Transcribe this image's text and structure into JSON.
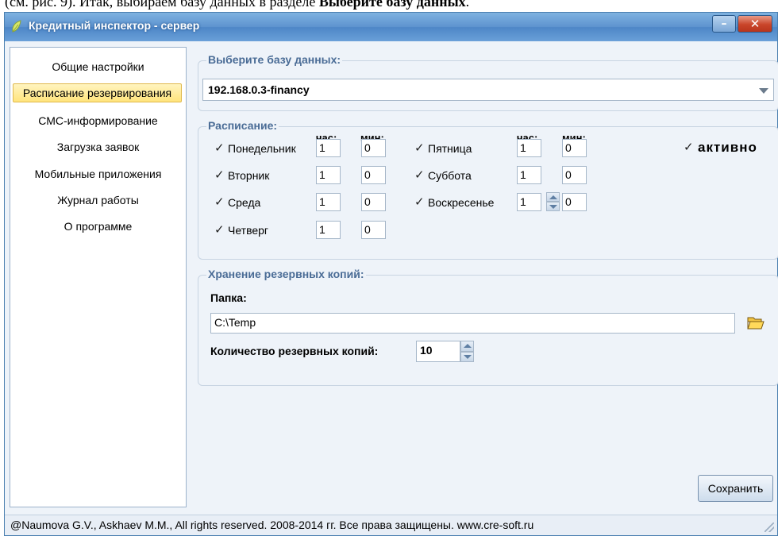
{
  "doc_text": {
    "prefix": "(см. рис. 9). Итак, выбираем базу данных в разделе ",
    "bold": "Выберите базу данных",
    "suffix": "."
  },
  "window": {
    "title": "Кредитный инспектор - сервер",
    "minimize_glyph": "–",
    "close_glyph": "✕"
  },
  "sidebar": {
    "items": [
      {
        "label": "Общие настройки"
      },
      {
        "label": "Расписание резервирования"
      },
      {
        "label": "СМС-информирование"
      },
      {
        "label": "Загрузка заявок"
      },
      {
        "label": "Мобильные приложения"
      },
      {
        "label": "Журнал работы"
      },
      {
        "label": "О программе"
      }
    ],
    "active_index": 1
  },
  "database": {
    "group_title": "Выберите базу данных:",
    "selected": "192.168.0.3-financy"
  },
  "schedule": {
    "group_title": "Расписание:",
    "hour_header": "час:",
    "min_header": "мин:",
    "active_label": "активно",
    "active_checked": true,
    "check_glyph": "✓",
    "days": [
      {
        "name": "Понедельник",
        "hour": "1",
        "min": "0",
        "checked": true
      },
      {
        "name": "Вторник",
        "hour": "1",
        "min": "0",
        "checked": true
      },
      {
        "name": "Среда",
        "hour": "1",
        "min": "0",
        "checked": true
      },
      {
        "name": "Четверг",
        "hour": "1",
        "min": "0",
        "checked": true
      },
      {
        "name": "Пятница",
        "hour": "1",
        "min": "0",
        "checked": true
      },
      {
        "name": "Суббота",
        "hour": "1",
        "min": "0",
        "checked": true
      },
      {
        "name": "Воскресенье",
        "hour": "1",
        "min": "0",
        "checked": true
      }
    ]
  },
  "backup": {
    "group_title": "Хранение резервных копий:",
    "folder_label": "Папка:",
    "folder_value": "C:\\Temp",
    "count_label": "Количество резервных копий:",
    "count_value": "10"
  },
  "save_label": "Сохранить",
  "status": "@Naumova G.V., Askhaev M.M., All rights reserved. 2008-2014 гг. Все права защищены. www.cre-soft.ru",
  "colors": {
    "titlebar": "#5d93cf",
    "group_title": "#4a6c96",
    "active_nav": "#ffe47c"
  }
}
